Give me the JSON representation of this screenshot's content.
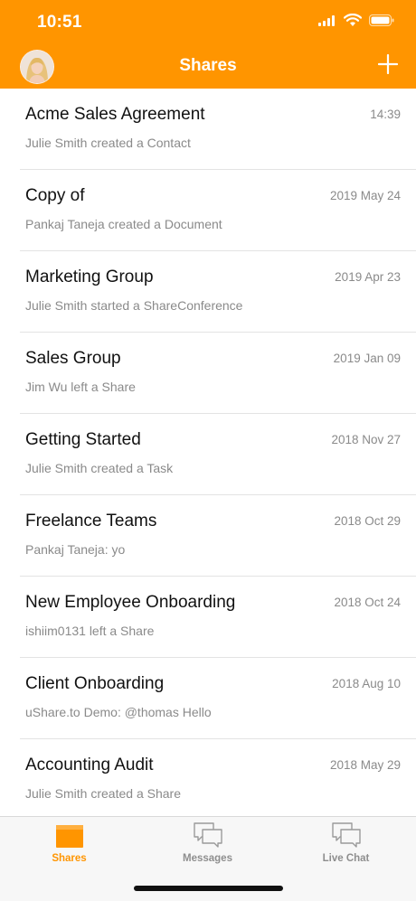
{
  "status_bar": {
    "time": "10:51"
  },
  "header": {
    "title": "Shares",
    "accent": "#ff9500"
  },
  "shares": [
    {
      "title": "Acme Sales Agreement",
      "subtitle": "Julie Smith created a Contact",
      "date": "14:39"
    },
    {
      "title": "Copy of",
      "subtitle": "Pankaj Taneja created a Document",
      "date": "2019 May 24"
    },
    {
      "title": "Marketing Group",
      "subtitle": "Julie Smith started a ShareConference",
      "date": "2019 Apr 23"
    },
    {
      "title": "Sales Group",
      "subtitle": "Jim Wu left a Share",
      "date": "2019 Jan 09"
    },
    {
      "title": "Getting Started",
      "subtitle": "Julie Smith created a Task",
      "date": "2018 Nov 27"
    },
    {
      "title": "Freelance Teams",
      "subtitle": "Pankaj Taneja: yo",
      "date": "2018 Oct 29"
    },
    {
      "title": "New Employee Onboarding",
      "subtitle": "ishiim0131  left a Share",
      "date": "2018 Oct 24"
    },
    {
      "title": "Client Onboarding",
      "subtitle": "uShare.to Demo: @thomas Hello",
      "date": "2018 Aug 10"
    },
    {
      "title": "Accounting Audit",
      "subtitle": "Julie Smith created a Share",
      "date": "2018 May 29"
    }
  ],
  "tabbar": {
    "tabs": [
      {
        "label": "Shares",
        "icon": "folder-icon",
        "active": true
      },
      {
        "label": "Messages",
        "icon": "chat-bubbles-icon",
        "active": false
      },
      {
        "label": "Live Chat",
        "icon": "chat-bubbles-icon",
        "active": false
      }
    ]
  }
}
